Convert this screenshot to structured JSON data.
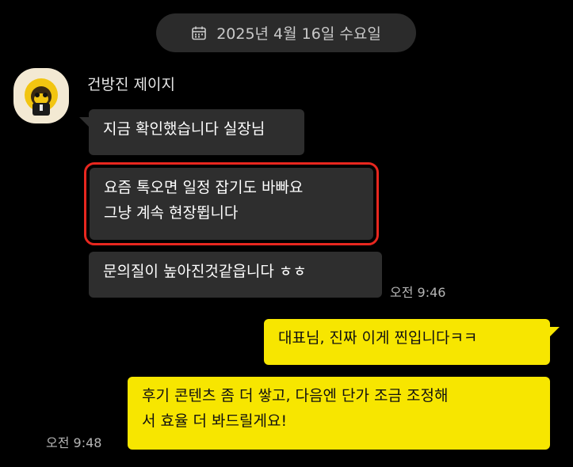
{
  "date_divider": {
    "icon": "calendar-icon",
    "text": "2025년 4월 16일 수요일"
  },
  "sender": {
    "name": "건방진 제이지",
    "avatar": "avatar-character"
  },
  "incoming": [
    {
      "lines": [
        "지금 확인했습니다 실장님"
      ]
    },
    {
      "lines": [
        "요즘 톡오면 일정 잡기도 바빠요",
        "그냥 계속 현장뜁니다"
      ]
    },
    {
      "lines": [
        "문의질이 높아진것같읍니다 ㅎㅎ"
      ]
    }
  ],
  "incoming_time": "오전 9:46",
  "outgoing": [
    {
      "lines": [
        "대표님, 진짜 이게 찐입니다ㅋㅋ"
      ]
    },
    {
      "lines": [
        "후기 콘텐츠 좀 더 쌓고, 다음엔 단가 조금 조정해",
        "서 효율 더 봐드릴게요!"
      ]
    }
  ],
  "outgoing_time": "오전 9:48",
  "colors": {
    "background": "#000000",
    "incoming_bubble": "#2e2e2e",
    "outgoing_bubble": "#f7e600",
    "highlight": "#e8271f"
  }
}
